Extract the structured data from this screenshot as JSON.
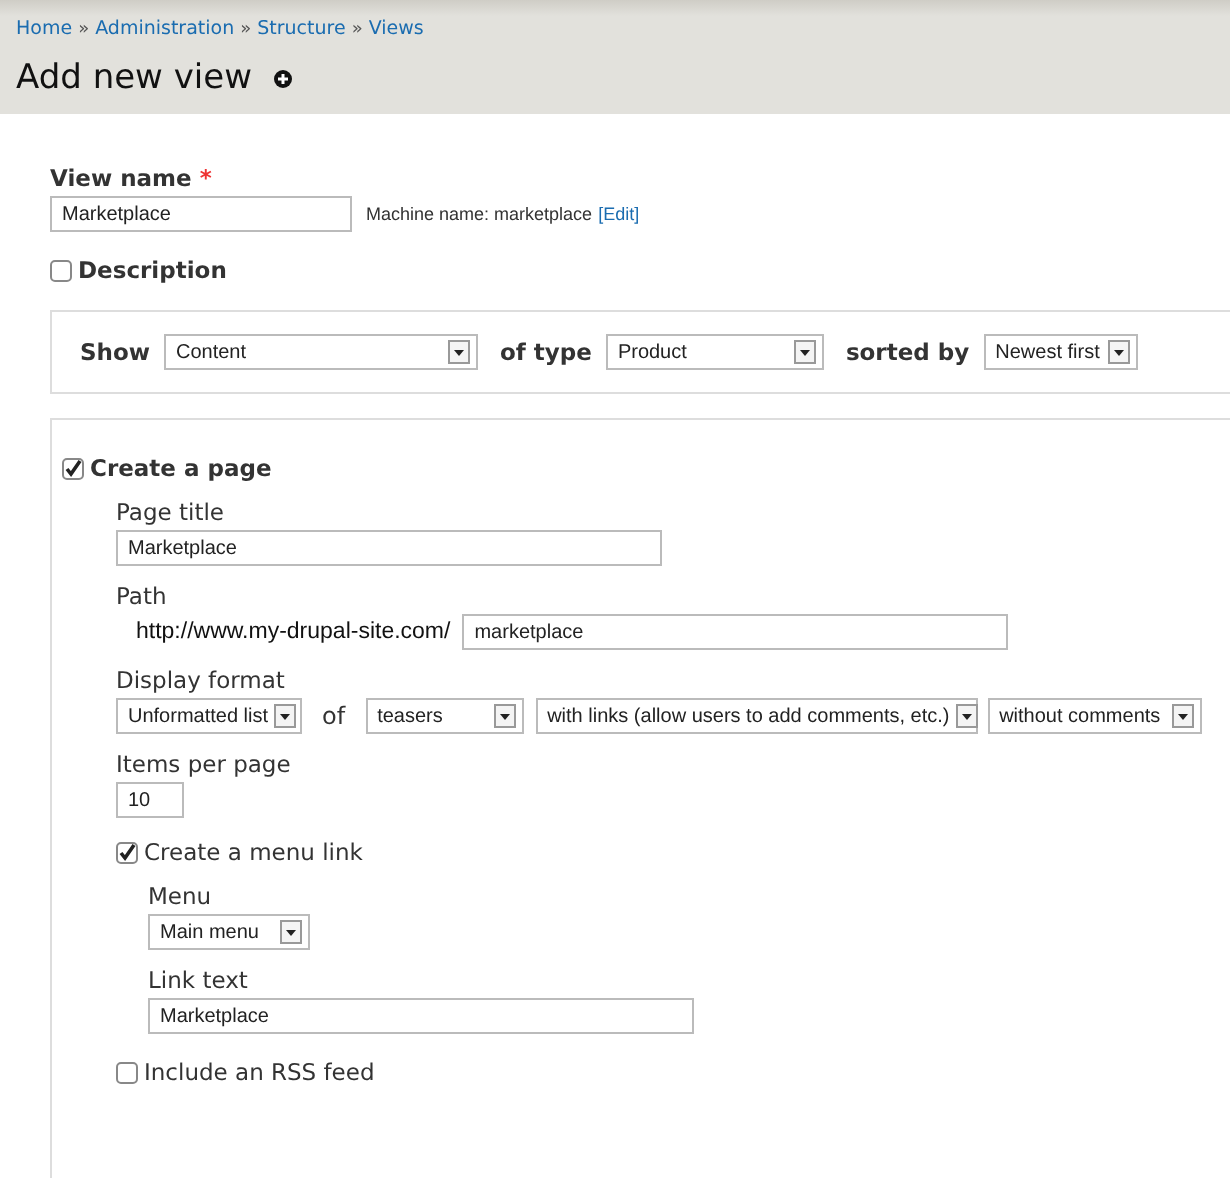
{
  "breadcrumb": {
    "separator": "»",
    "items": [
      {
        "label": "Home"
      },
      {
        "label": "Administration"
      },
      {
        "label": "Structure"
      },
      {
        "label": "Views"
      }
    ]
  },
  "title": "Add new view",
  "view_name": {
    "label": "View name",
    "required_mark": "*",
    "value": "Marketplace",
    "machine_name": "Machine name: marketplace",
    "edit_link": "[Edit]"
  },
  "description": {
    "label": "Description",
    "checked": false
  },
  "show": {
    "label": "Show",
    "value": "Content",
    "type_label": "of type",
    "type_value": "Product",
    "sort_label": "sorted by",
    "sort_value": "Newest first"
  },
  "create_page": {
    "label": "Create a page",
    "checked": true,
    "page_title": {
      "label": "Page title",
      "value": "Marketplace"
    },
    "path": {
      "label": "Path",
      "prefix": "http://www.my-drupal-site.com/",
      "value": "marketplace"
    },
    "display_format": {
      "label": "Display format",
      "style": "Unformatted list",
      "of_label": "of",
      "row": "teasers",
      "links": "with links (allow users to add comments, etc.)",
      "comments": "without comments"
    },
    "items_per_page": {
      "label": "Items per page",
      "value": "10"
    },
    "menu_link": {
      "label": "Create a menu link",
      "checked": true,
      "menu": {
        "label": "Menu",
        "value": "Main menu"
      },
      "link_text": {
        "label": "Link text",
        "value": "Marketplace"
      }
    },
    "rss": {
      "label": "Include an RSS feed",
      "checked": false
    }
  }
}
